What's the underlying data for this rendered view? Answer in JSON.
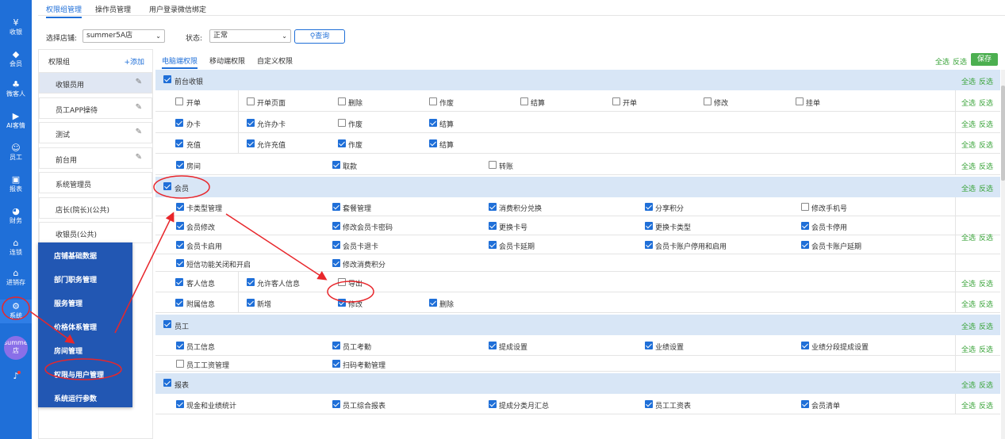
{
  "leftnav": {
    "items": [
      {
        "label": "收银",
        "icon": "cashier-icon",
        "glyph": "¥"
      },
      {
        "label": "会员",
        "icon": "diamond-icon",
        "glyph": "◆"
      },
      {
        "label": "微客人",
        "icon": "clover-icon",
        "glyph": "♣"
      },
      {
        "label": "AI客情",
        "icon": "play-circle-icon",
        "glyph": "▶"
      },
      {
        "label": "员工",
        "icon": "person-icon",
        "glyph": "☺"
      },
      {
        "label": "报表",
        "icon": "monitor-icon",
        "glyph": "▣"
      },
      {
        "label": "财务",
        "icon": "pie-chart-icon",
        "glyph": "◕"
      },
      {
        "label": "连锁",
        "icon": "chain-store-icon",
        "glyph": "⌂"
      },
      {
        "label": "进销存",
        "icon": "warehouse-icon",
        "glyph": "⌂"
      },
      {
        "label": "系统",
        "icon": "gear-icon",
        "glyph": "⚙"
      }
    ],
    "avatar_text": "summer5A店"
  },
  "top_tabs": [
    "权限组管理",
    "操作员管理",
    "用户登录微信绑定"
  ],
  "filter": {
    "store_label": "选择店铺:",
    "store_value": "summer5A店",
    "status_label": "状态:",
    "status_value": "正常",
    "query_label": "查询"
  },
  "groups": {
    "title": "权限组",
    "add_label": "+添加",
    "items": [
      "收银员用",
      "员工APP操待",
      "测试",
      "前台用",
      "系统管理员",
      "店长(院长)(公共)",
      "收银员(公共)"
    ]
  },
  "popup_menu": [
    "店铺基础数据",
    "部门职务管理",
    "服务管理",
    "价格体系管理",
    "房间管理",
    "权限与用户管理",
    "系统运行参数"
  ],
  "perm": {
    "sub_tabs": [
      "电脑端权限",
      "移动端权限",
      "自定义权限"
    ],
    "select_all": "全选",
    "invert": "反选",
    "save": "保存",
    "sections": [
      {
        "label": "前台收银",
        "rows": [
          {
            "left": {
              "text": "开单",
              "checked": false
            },
            "items": [
              {
                "text": "开单页面",
                "checked": false
              },
              {
                "text": "删除",
                "checked": false
              },
              {
                "text": "作废",
                "checked": false
              },
              {
                "text": "结算",
                "checked": false
              },
              {
                "text": "开单",
                "checked": false
              },
              {
                "text": "修改",
                "checked": false
              },
              {
                "text": "挂单",
                "checked": false
              }
            ]
          },
          {
            "left": {
              "text": "办卡",
              "checked": true
            },
            "items": [
              {
                "text": "允许办卡",
                "checked": true
              },
              {
                "text": "作废",
                "checked": false
              },
              {
                "text": "结算",
                "checked": true
              }
            ]
          },
          {
            "left": {
              "text": "充值",
              "checked": true
            },
            "items": [
              {
                "text": "允许充值",
                "checked": true
              },
              {
                "text": "作废",
                "checked": true
              },
              {
                "text": "结算",
                "checked": true
              }
            ]
          },
          {
            "flat": true,
            "items": [
              {
                "text": "房间",
                "checked": true
              },
              {
                "text": "取款",
                "checked": true
              },
              {
                "text": "转账",
                "checked": false
              }
            ]
          }
        ]
      },
      {
        "label": "会员",
        "rows": [
          {
            "flat": true,
            "items": [
              {
                "text": "卡类型管理",
                "checked": true
              },
              {
                "text": "套餐管理",
                "checked": true
              },
              {
                "text": "消费积分兑换",
                "checked": true
              },
              {
                "text": "分享积分",
                "checked": true
              },
              {
                "text": "修改手机号",
                "checked": false
              }
            ]
          },
          {
            "flat": true,
            "items": [
              {
                "text": "会员修改",
                "checked": true
              },
              {
                "text": "修改会员卡密码",
                "checked": true
              },
              {
                "text": "更换卡号",
                "checked": true
              },
              {
                "text": "更换卡类型",
                "checked": true
              },
              {
                "text": "会员卡停用",
                "checked": true
              }
            ]
          },
          {
            "flat": true,
            "items": [
              {
                "text": "会员卡启用",
                "checked": true
              },
              {
                "text": "会员卡退卡",
                "checked": true
              },
              {
                "text": "会员卡延期",
                "checked": true
              },
              {
                "text": "会员卡账户停用和启用",
                "checked": true
              },
              {
                "text": "会员卡账户延期",
                "checked": true
              }
            ]
          },
          {
            "flat": true,
            "items": [
              {
                "text": "短信功能关闭和开启",
                "checked": true
              },
              {
                "text": "修改消费积分",
                "checked": true
              }
            ]
          },
          {
            "left": {
              "text": "客人信息",
              "checked": true
            },
            "items": [
              {
                "text": "允许客人信息",
                "checked": true
              },
              {
                "text": "导出",
                "checked": false
              }
            ]
          },
          {
            "left": {
              "text": "附属信息",
              "checked": true
            },
            "items": [
              {
                "text": "新增",
                "checked": true
              },
              {
                "text": "修改",
                "checked": true
              },
              {
                "text": "删除",
                "checked": true
              }
            ]
          }
        ]
      },
      {
        "label": "员工",
        "rows": [
          {
            "flat": true,
            "items": [
              {
                "text": "员工信息",
                "checked": true
              },
              {
                "text": "员工考勤",
                "checked": true
              },
              {
                "text": "提成设置",
                "checked": true
              },
              {
                "text": "业绩设置",
                "checked": true
              },
              {
                "text": "业绩分段提成设置",
                "checked": true
              }
            ]
          },
          {
            "flat": true,
            "items": [
              {
                "text": "员工工资管理",
                "checked": false
              },
              {
                "text": "扫码考勤管理",
                "checked": true
              }
            ]
          }
        ]
      },
      {
        "label": "报表",
        "rows": [
          {
            "flat": true,
            "items": [
              {
                "text": "现金和业绩统计",
                "checked": true
              },
              {
                "text": "员工综合报表",
                "checked": true
              },
              {
                "text": "提成分类月汇总",
                "checked": true
              },
              {
                "text": "员工工资表",
                "checked": true
              },
              {
                "text": "会员清单",
                "checked": true
              }
            ]
          }
        ]
      }
    ]
  },
  "colors": {
    "accent": "#1f6fd8",
    "annotation": "#e8262b",
    "green": "#3aa43a"
  }
}
